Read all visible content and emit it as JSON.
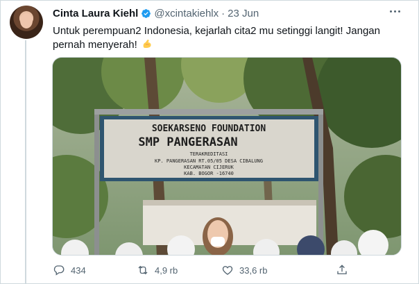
{
  "tweet": {
    "author_name": "Cinta Laura Kiehl",
    "handle": "@xcintakiehlx",
    "separator": "·",
    "date": "23 Jun",
    "text": "Untuk perempuan2 Indonesia, kejarlah cita2 mu setinggi langit! Jangan pernah menyerah!",
    "emoji_icon": "flexed-biceps-emoji",
    "verified_color": "#1d9bf0"
  },
  "media": {
    "sign": {
      "line1": "SOEKARSENO FOUNDATION",
      "line2": "SMP PANGERASAN",
      "line3": "TERAKREDITASI",
      "line4": "KP. PANGERASAN RT.05/05 DESA CIBALUNG",
      "line5": "KECAMATAN CIJERUK",
      "line6": "KAB. BOGOR -16740"
    }
  },
  "actions": {
    "reply_count": "434",
    "retweet_count": "4,9 rb",
    "like_count": "33,6 rb"
  },
  "colors": {
    "text": "#0f1419",
    "secondary": "#536471",
    "border": "#cfd9de"
  }
}
